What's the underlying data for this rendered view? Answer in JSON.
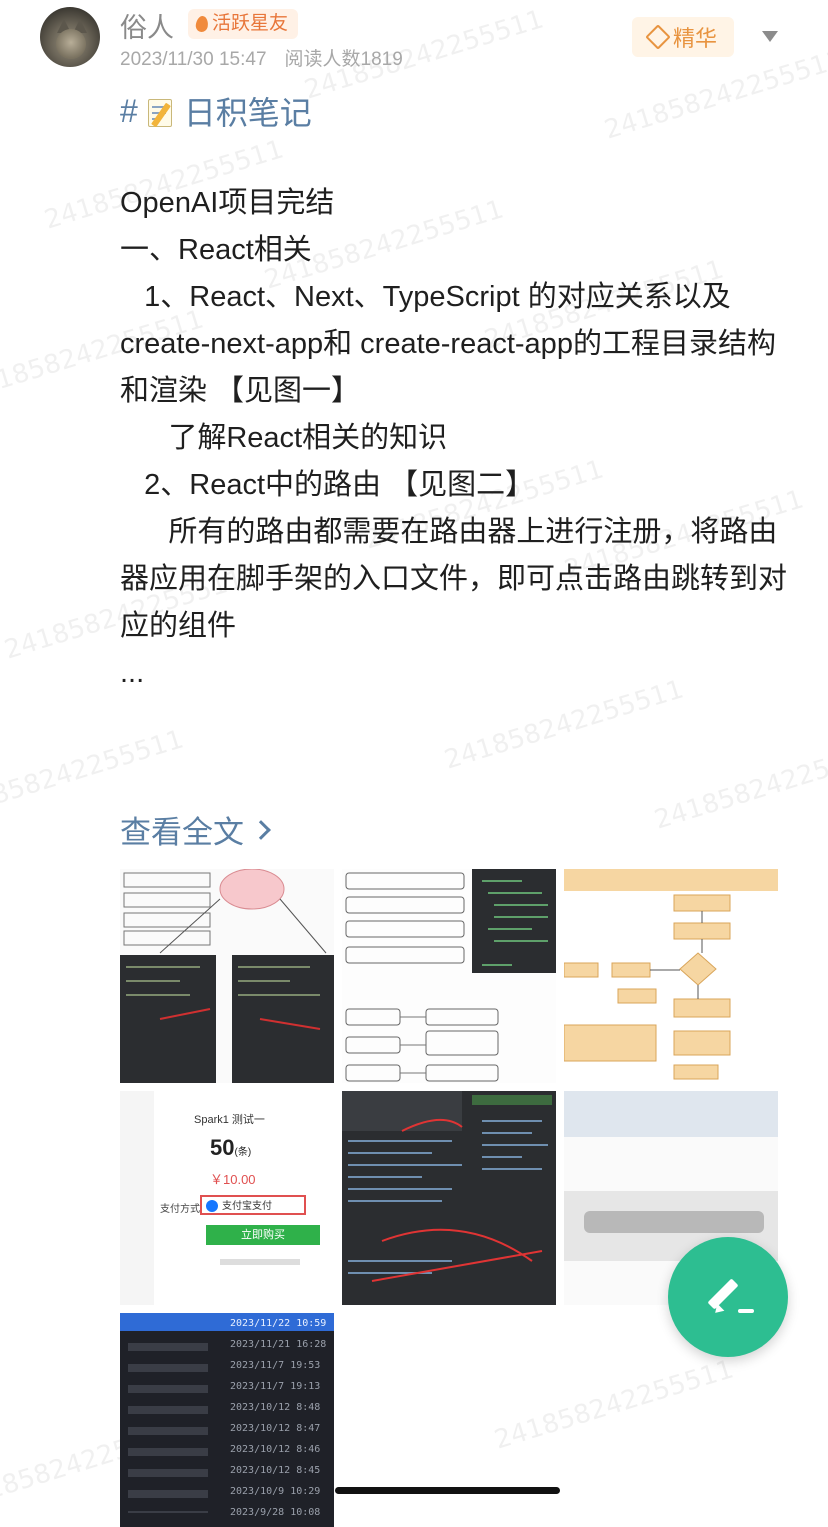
{
  "post": {
    "author": "俗人",
    "badge": "活跃星友",
    "date": "2023/11/30 15:47",
    "reads": "阅读人数1819",
    "essence_label": "精华",
    "topic": "日积笔记",
    "topic_prefix": "#",
    "body": [
      "OpenAI项目完结",
      "",
      "一、React相关",
      "   1、React、Next、TypeScript 的对应关系以及create-next-app和 create-react-app的工程目录结构和渲染 【见图一】",
      "      了解React相关的知识",
      "",
      "   2、React中的路由 【见图二】",
      "      所有的路由都需要在路由器上进行注册，将路由器应用在脚手架的入口文件，即可点击路由跳转到对应的组件",
      "..."
    ],
    "see_all": "查看全文",
    "watermark": "241858242255511"
  },
  "images": [
    {
      "name": "image-1",
      "kind": "mindmap-code"
    },
    {
      "name": "image-2",
      "kind": "routing-code"
    },
    {
      "name": "image-3",
      "kind": "flowchart"
    },
    {
      "name": "image-4",
      "kind": "payment"
    },
    {
      "name": "image-5",
      "kind": "code-screenshot"
    },
    {
      "name": "image-6",
      "kind": "blurred"
    },
    {
      "name": "image-7",
      "kind": "dates-list"
    }
  ],
  "payment": {
    "title": "Spark1 测试一",
    "count": "50",
    "count_unit": "(条)",
    "price": "￥10.00",
    "method_label": "支付方式",
    "method": "支付宝支付",
    "pay_button": "立即购买"
  },
  "dates": [
    "2023/11/22 10:59",
    "2023/11/21 16:28",
    "2023/11/7 19:53",
    "2023/11/7 19:13",
    "2023/10/12 8:48",
    "2023/10/12 8:47",
    "2023/10/12 8:46",
    "2023/10/12 8:45",
    "2023/10/9 10:29",
    "2023/9/28 10:08"
  ],
  "colors": {
    "accent": "#5a7ea3",
    "fab": "#2dbe91",
    "badge": "#e8763a",
    "essence": "#e89440"
  },
  "icons": [
    "flame-icon",
    "diamond-icon",
    "chevron-down-icon",
    "memo-icon",
    "chevron-right-icon",
    "edit-icon"
  ]
}
